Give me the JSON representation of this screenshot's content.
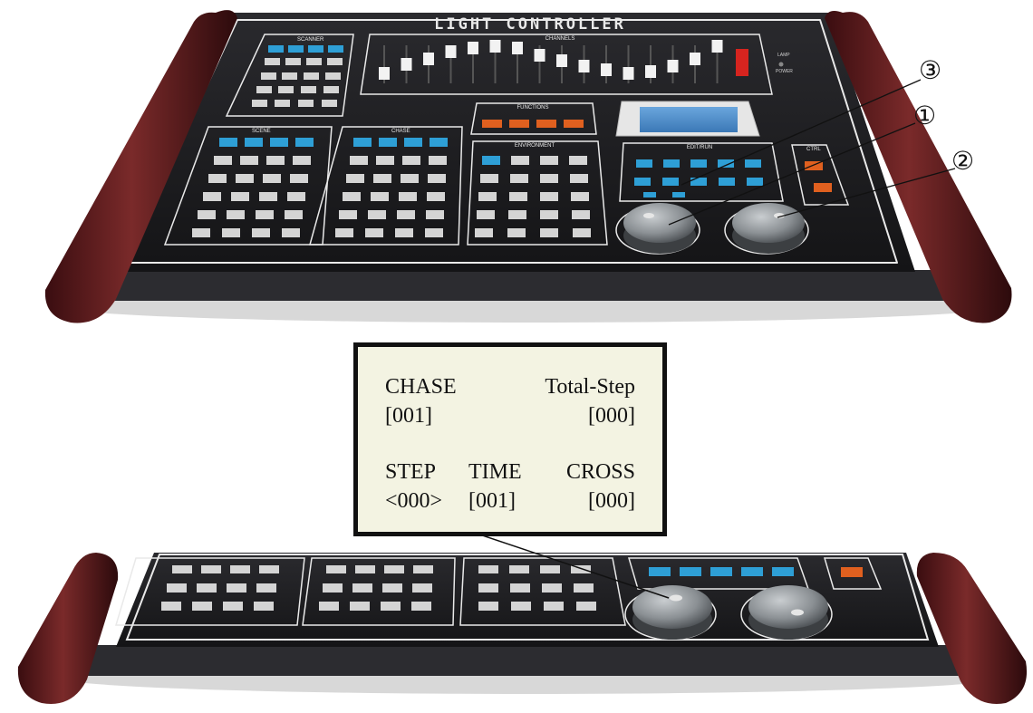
{
  "console_top": {
    "brand_label": "LIGHT CONTROLLER",
    "sections": {
      "scanner": "SCANNER",
      "channels": "CHANNELS",
      "functions": "FUNCTIONS",
      "scene": "SCENE",
      "chase": "CHASE",
      "environment": "ENVIRONMENT",
      "edit_run": "EDIT/RUN",
      "ctrl": "CTRL",
      "lamp": "LAMP",
      "power": "POWER"
    },
    "callouts": [
      "③",
      "①",
      "②"
    ],
    "fader_count": 16
  },
  "lcd": {
    "row1_left": "CHASE",
    "row1_right": "Total-Step",
    "row2_left": "[001]",
    "row2_right": "[000]",
    "row3_col1": "STEP",
    "row3_col2": "TIME",
    "row3_col3": "CROSS",
    "row4_col1": "<000>",
    "row4_col2": "[001]",
    "row4_col3": "[000]"
  },
  "colors": {
    "console_body": "#1b1b1e",
    "wood_end": "#5a1a1c",
    "panel_line": "#e9e9e9",
    "blue_button": "#2e9fd6",
    "orange_button": "#e0601f",
    "grey_button": "#d4d4d4",
    "lcd_background": "#f3f3e2",
    "lcd_screen": "#4f8fce",
    "knob": "#8a8f93"
  }
}
